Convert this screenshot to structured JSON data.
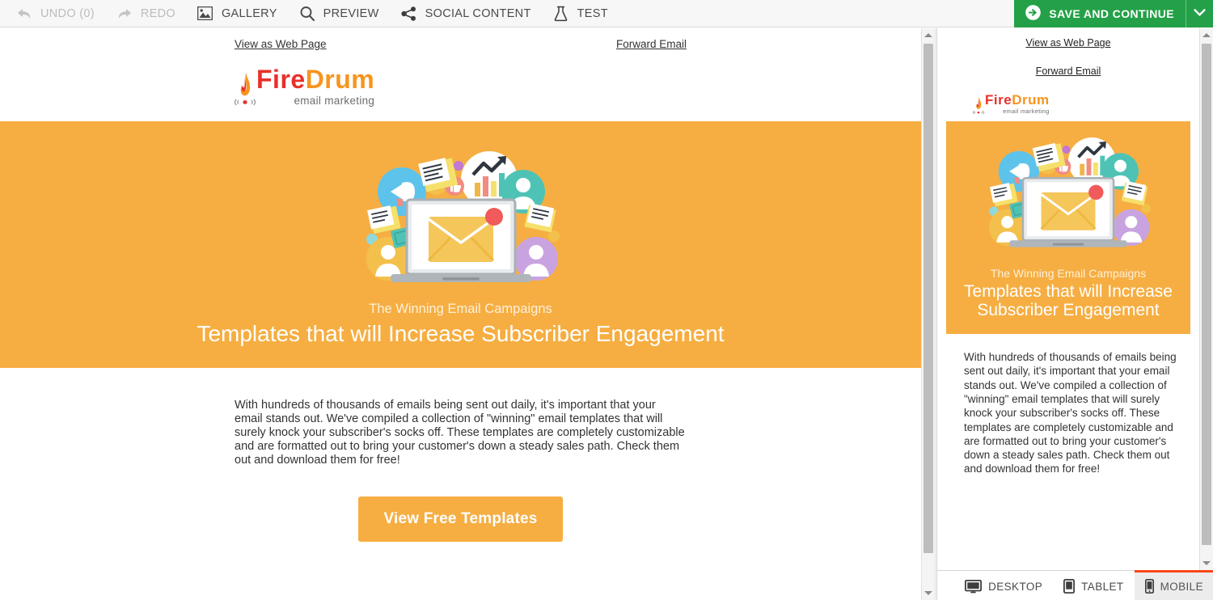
{
  "toolbar": {
    "items": [
      {
        "label": "UNDO (0)",
        "icon": "undo-arrow-icon",
        "disabled": true
      },
      {
        "label": "REDO",
        "icon": "redo-arrow-icon",
        "disabled": true
      },
      {
        "label": "GALLERY",
        "icon": "image-icon",
        "disabled": false
      },
      {
        "label": "PREVIEW",
        "icon": "magnifier-icon",
        "disabled": false
      },
      {
        "label": "SOCIAL CONTENT",
        "icon": "share-nodes-icon",
        "disabled": false
      },
      {
        "label": "TEST",
        "icon": "flask-icon",
        "disabled": false
      }
    ],
    "save_label": "SAVE AND CONTINUE",
    "save_icon": "arrow-right-circle-icon",
    "save_caret_icon": "chevron-down-icon",
    "save_color": "#24a148"
  },
  "email": {
    "view_as_web_page": "View as Web Page",
    "forward_email": "Forward Email",
    "logo": {
      "part1": "Fire",
      "part2": "Drum",
      "tagline": "email marketing",
      "part1_color": "#e8302a",
      "part2_color": "#f7941e"
    },
    "hero": {
      "kicker": "The Winning Email Campaigns",
      "title": "Templates that will Increase Subscriber Engagement",
      "background_color": "#f6ae42"
    },
    "body": "With hundreds of thousands of emails being sent out daily, it's important that your email stands out. We've compiled a collection of \"winning\" email templates that will surely knock your subscriber's socks off. These templates are completely customizable and are formatted out to bring your customer's down a steady sales path. Check them out and download them for free!",
    "cta_label": "View Free Templates",
    "cta_color": "#f6ae42"
  },
  "preview": {
    "devices": [
      {
        "label": "DESKTOP",
        "icon": "monitor-icon",
        "active": false
      },
      {
        "label": "TABLET",
        "icon": "tablet-icon",
        "active": false
      },
      {
        "label": "MOBILE",
        "icon": "smartphone-icon",
        "active": true
      }
    ],
    "active_indicator_color": "#fa4616"
  }
}
